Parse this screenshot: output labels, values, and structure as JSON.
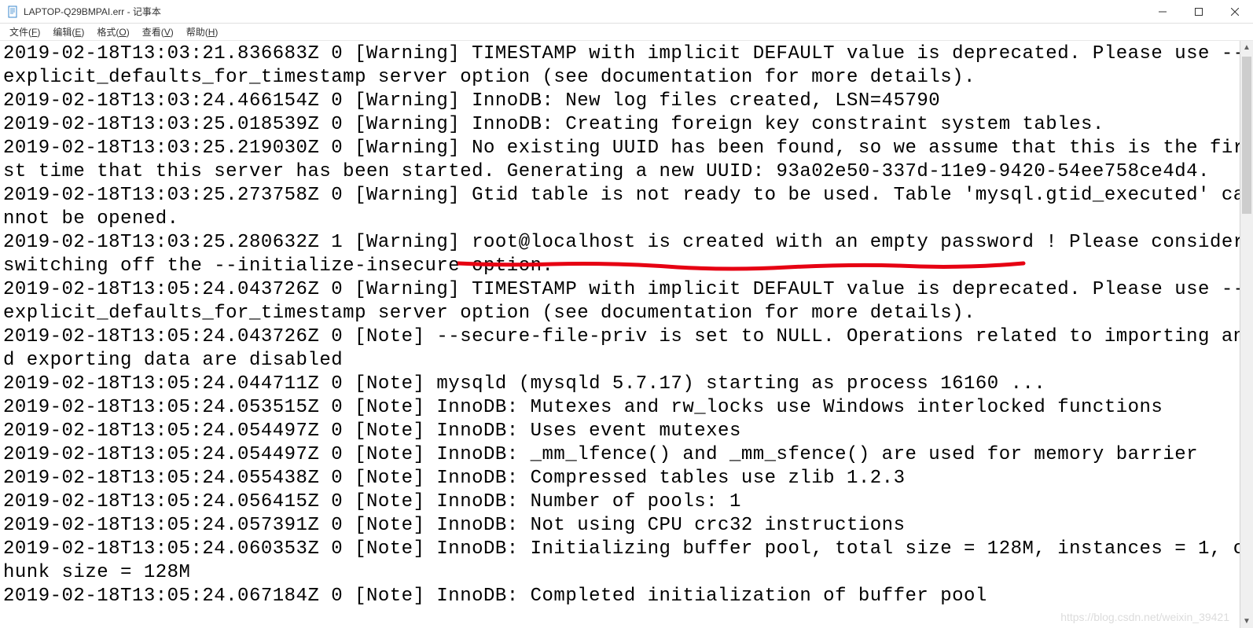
{
  "window": {
    "title": "LAPTOP-Q29BMPAI.err - 记事本"
  },
  "menu": {
    "file": "文件(",
    "file_key": "F",
    "file_close": ")",
    "edit": "编辑(",
    "edit_key": "E",
    "edit_close": ")",
    "format": "格式(",
    "format_key": "O",
    "format_close": ")",
    "view": "查看(",
    "view_key": "V",
    "view_close": ")",
    "help": "帮助(",
    "help_key": "H",
    "help_close": ")"
  },
  "content": "2019-02-18T13:03:21.836683Z 0 [Warning] TIMESTAMP with implicit DEFAULT value is deprecated. Please use --explicit_defaults_for_timestamp server option (see documentation for more details).\n2019-02-18T13:03:24.466154Z 0 [Warning] InnoDB: New log files created, LSN=45790\n2019-02-18T13:03:25.018539Z 0 [Warning] InnoDB: Creating foreign key constraint system tables.\n2019-02-18T13:03:25.219030Z 0 [Warning] No existing UUID has been found, so we assume that this is the first time that this server has been started. Generating a new UUID: 93a02e50-337d-11e9-9420-54ee758ce4d4.\n2019-02-18T13:03:25.273758Z 0 [Warning] Gtid table is not ready to be used. Table 'mysql.gtid_executed' cannot be opened.\n2019-02-18T13:03:25.280632Z 1 [Warning] root@localhost is created with an empty password ! Please consider switching off the --initialize-insecure option.\n2019-02-18T13:05:24.043726Z 0 [Warning] TIMESTAMP with implicit DEFAULT value is deprecated. Please use --explicit_defaults_for_timestamp server option (see documentation for more details).\n2019-02-18T13:05:24.043726Z 0 [Note] --secure-file-priv is set to NULL. Operations related to importing and exporting data are disabled\n2019-02-18T13:05:24.044711Z 0 [Note] mysqld (mysqld 5.7.17) starting as process 16160 ...\n2019-02-18T13:05:24.053515Z 0 [Note] InnoDB: Mutexes and rw_locks use Windows interlocked functions\n2019-02-18T13:05:24.054497Z 0 [Note] InnoDB: Uses event mutexes\n2019-02-18T13:05:24.054497Z 0 [Note] InnoDB: _mm_lfence() and _mm_sfence() are used for memory barrier\n2019-02-18T13:05:24.055438Z 0 [Note] InnoDB: Compressed tables use zlib 1.2.3\n2019-02-18T13:05:24.056415Z 0 [Note] InnoDB: Number of pools: 1\n2019-02-18T13:05:24.057391Z 0 [Note] InnoDB: Not using CPU crc32 instructions\n2019-02-18T13:05:24.060353Z 0 [Note] InnoDB: Initializing buffer pool, total size = 128M, instances = 1, chunk size = 128M\n2019-02-18T13:05:24.067184Z 0 [Note] InnoDB: Completed initialization of buffer pool",
  "watermark": "https://blog.csdn.net/weixin_39421"
}
